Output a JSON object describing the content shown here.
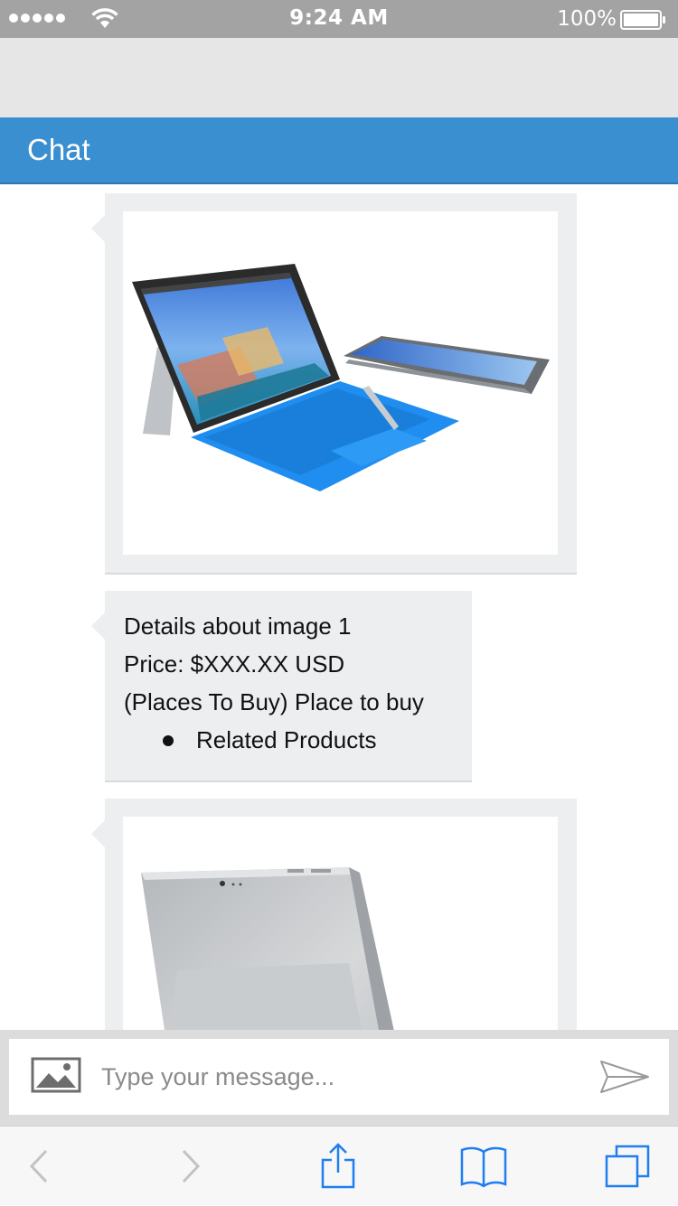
{
  "status_bar": {
    "time": "9:24 AM",
    "battery": "100%"
  },
  "header": {
    "title": "Chat"
  },
  "messages": [
    {
      "type": "image",
      "alt": "Surface Pro 4 with keyboard and pen"
    },
    {
      "type": "text",
      "lines": [
        "Details about image 1",
        "Price: $XXX.XX USD",
        "(Places To Buy) Place to buy"
      ],
      "bullets": [
        "Related Products"
      ]
    },
    {
      "type": "image",
      "alt": "Surface Pro back with kickstand"
    }
  ],
  "composer": {
    "placeholder": "Type your message..."
  },
  "colors": {
    "header_bg": "#3a8fd0",
    "bubble_bg": "#eceef0",
    "browser_icon": "#1f7ef0"
  },
  "icons": [
    "signal-dots-icon",
    "wifi-icon",
    "battery-icon",
    "image-upload-icon",
    "send-icon",
    "back-icon",
    "forward-icon",
    "share-icon",
    "bookmarks-icon",
    "tabs-icon"
  ]
}
